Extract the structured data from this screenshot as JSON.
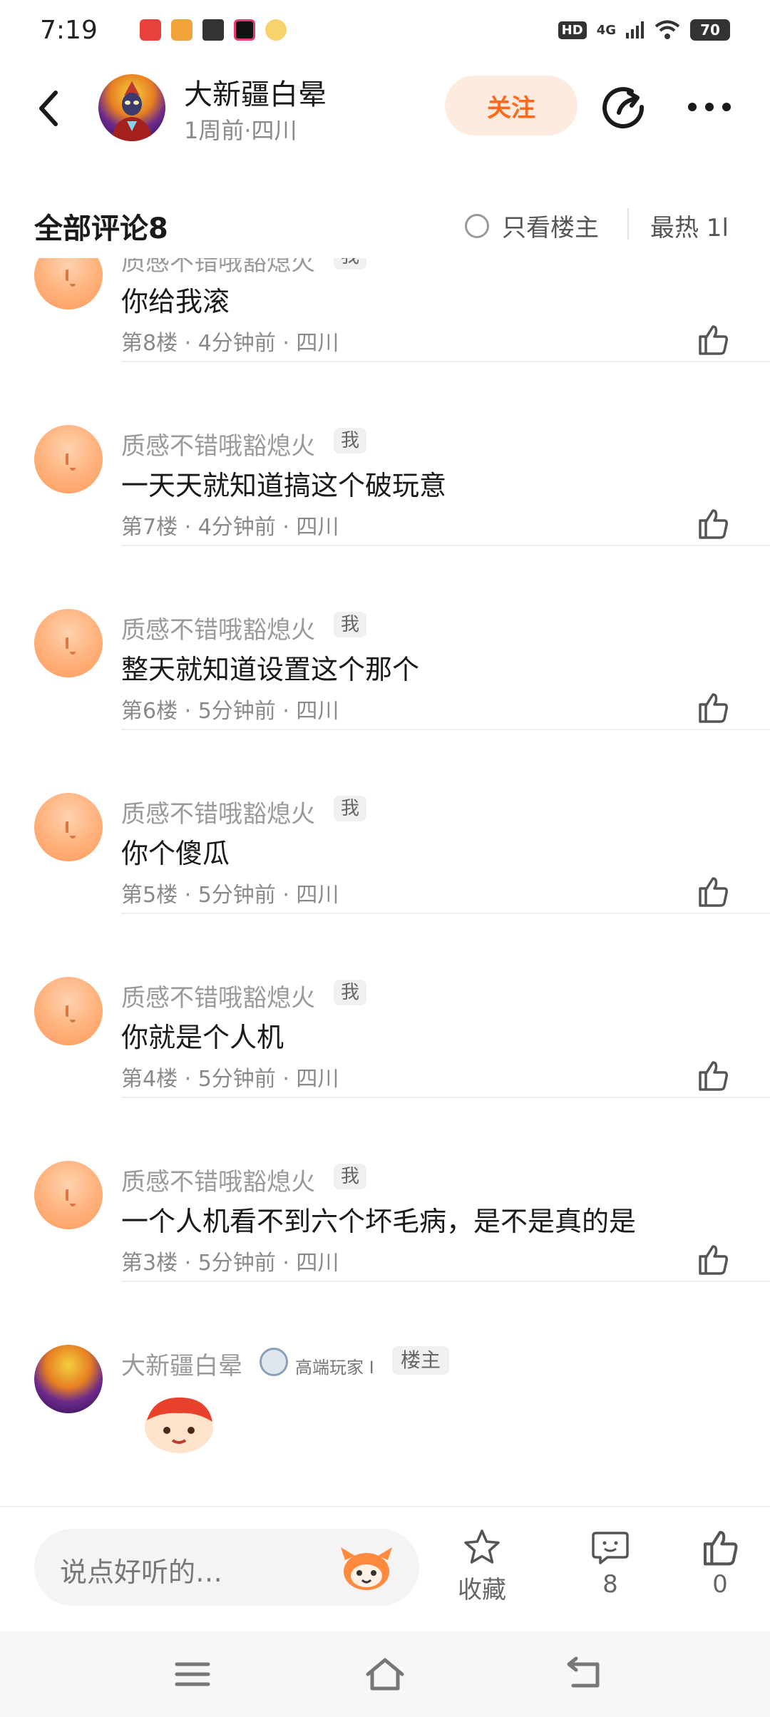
{
  "status_bar": {
    "time": "7:19",
    "hd": "HD",
    "network": "4G",
    "battery": "70"
  },
  "header": {
    "username": "大新疆白晕",
    "meta": "1周前·四川",
    "follow_label": "关注"
  },
  "comments_header": {
    "title": "全部评论8",
    "only_op_label": "只看楼主",
    "sort_label": "最热 1l"
  },
  "comments": [
    {
      "user": "质感不错哦豁熄火",
      "tag": "我",
      "text": "你给我滚",
      "meta": "第8楼 · 4分钟前 · 四川"
    },
    {
      "user": "质感不错哦豁熄火",
      "tag": "我",
      "text": "一天天就知道搞这个破玩意",
      "meta": "第7楼 · 4分钟前 · 四川"
    },
    {
      "user": "质感不错哦豁熄火",
      "tag": "我",
      "text": "整天就知道设置这个那个",
      "meta": "第6楼 · 5分钟前 · 四川"
    },
    {
      "user": "质感不错哦豁熄火",
      "tag": "我",
      "text": "你个傻瓜",
      "meta": "第5楼 · 5分钟前 · 四川"
    },
    {
      "user": "质感不错哦豁熄火",
      "tag": "我",
      "text": "你就是个人机",
      "meta": "第4楼 · 5分钟前 · 四川"
    },
    {
      "user": "质感不错哦豁熄火",
      "tag": "我",
      "text": "一个人机看不到六个坏毛病，是不是真的是",
      "meta": "第3楼 · 5分钟前 · 四川"
    }
  ],
  "op_comment": {
    "user": "大新疆白晕",
    "badge": "高端玩家 I",
    "tag": "楼主"
  },
  "bottom_bar": {
    "placeholder": "说点好听的…",
    "favorite_label": "收藏",
    "comment_count": "8",
    "like_count": "0"
  },
  "colors": {
    "accent": "#ff6a1a",
    "follow_bg": "#fdebe0",
    "muted_text": "#8a8a8a"
  }
}
